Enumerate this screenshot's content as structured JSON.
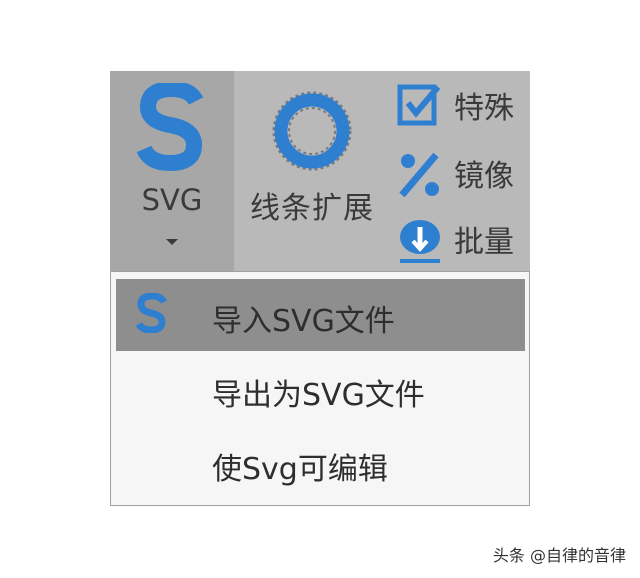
{
  "ribbon": {
    "svg_button": {
      "label": "SVG",
      "icon": "svg-s-icon"
    },
    "line_extend_button": {
      "label": "线条扩展",
      "icon": "ring-icon"
    },
    "side_items": [
      {
        "label": "特殊",
        "icon": "checkbox-icon"
      },
      {
        "label": "镜像",
        "icon": "percent-icon"
      },
      {
        "label": "批量",
        "icon": "batch-icon"
      }
    ]
  },
  "dropdown": {
    "items": [
      {
        "label": "导入SVG文件",
        "icon": "svg-s-icon",
        "highlighted": true
      },
      {
        "label": "导出为SVG文件",
        "highlighted": false
      },
      {
        "label": "使Svg可编辑",
        "highlighted": false
      }
    ]
  },
  "watermark": "头条 @自律的音律",
  "colors": {
    "accent": "#2f7fd1",
    "ribbon_bg": "#b9b9b9",
    "svg_button_bg": "#a7a7a7",
    "menu_bg": "#f6f6f6",
    "menu_highlight": "#8e8e8e"
  }
}
